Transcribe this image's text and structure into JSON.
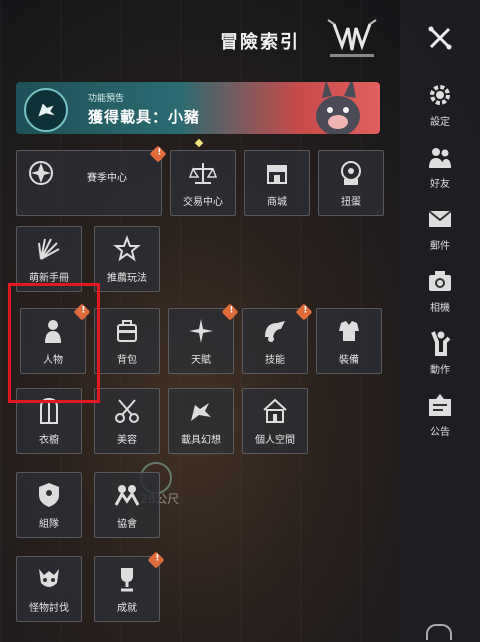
{
  "header": {
    "title": "冒險索引"
  },
  "banner": {
    "subtitle": "功能預告",
    "text": "獲得載具：小豬"
  },
  "tiles": [
    {
      "label": "賽季中心",
      "icon": "season-emblem-icon",
      "badge": "!"
    },
    {
      "label": "交易中心",
      "icon": "scales-icon"
    },
    {
      "label": "商城",
      "icon": "shop-icon"
    },
    {
      "label": "扭蛋",
      "icon": "gacha-icon"
    },
    {
      "label": "萌新手冊",
      "icon": "fan-icon"
    },
    {
      "label": "推薦玩法",
      "icon": "star-badge-icon"
    },
    {
      "label": "人物",
      "icon": "person-icon",
      "badge": "!"
    },
    {
      "label": "背包",
      "icon": "backpack-icon"
    },
    {
      "label": "天賦",
      "icon": "compass-star-icon",
      "badge": "!"
    },
    {
      "label": "技能",
      "icon": "skill-icon",
      "badge": "!"
    },
    {
      "label": "裝備",
      "icon": "armor-icon"
    },
    {
      "label": "衣櫥",
      "icon": "wardrobe-icon"
    },
    {
      "label": "美容",
      "icon": "scissors-icon"
    },
    {
      "label": "載具幻想",
      "icon": "dragon-mount-icon"
    },
    {
      "label": "個人空間",
      "icon": "house-icon"
    },
    {
      "label": "組隊",
      "icon": "team-shield-icon"
    },
    {
      "label": "協會",
      "icon": "guild-icon"
    },
    {
      "label": "怪物討伐",
      "icon": "monster-icon"
    },
    {
      "label": "成就",
      "icon": "trophy-icon",
      "badge": "!"
    }
  ],
  "sidebar": {
    "items": [
      {
        "label": "設定",
        "icon": "gear-icon"
      },
      {
        "label": "好友",
        "icon": "friends-icon"
      },
      {
        "label": "郵件",
        "icon": "mail-icon"
      },
      {
        "label": "相機",
        "icon": "camera-icon"
      },
      {
        "label": "動作",
        "icon": "gesture-icon"
      },
      {
        "label": "公告",
        "icon": "announcement-icon"
      }
    ]
  },
  "background": {
    "distance_text": "28公尺"
  },
  "colors": {
    "badge": "#e06a3a",
    "highlight": "#e0191f",
    "banner_teal": "#2c6b72",
    "banner_red": "#e06060"
  }
}
